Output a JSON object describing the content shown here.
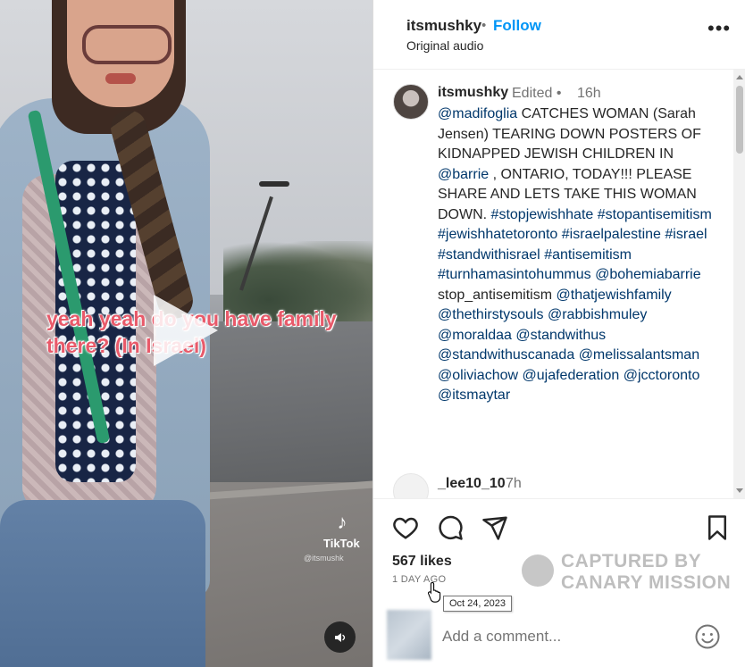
{
  "video": {
    "overlay_text": "yeah yeah do you have family there? (In Israel)",
    "tiktok_label": "TikTok",
    "tiktok_handle": "@itsmushk"
  },
  "header": {
    "username": "itsmushky",
    "separator": "•",
    "follow_label": "Follow",
    "audio_label": "Original audio",
    "more_icon": "more-horizontal-icon"
  },
  "caption": {
    "username": "itsmushky",
    "edited": "Edited •",
    "time": "16h",
    "segments": [
      {
        "text": "@madifoglia",
        "tag": true
      },
      {
        "text": " CATCHES WOMAN (Sarah Jensen) TEARING DOWN POSTERS OF KIDNAPPED JEWISH CHILDREN IN ",
        "tag": false
      },
      {
        "text": "@barrie",
        "tag": true
      },
      {
        "text": " , ONTARIO, TODAY!!! PLEASE SHARE AND LETS TAKE THIS WOMAN DOWN. ",
        "tag": false
      },
      {
        "text": "#stopjewishhate",
        "tag": true
      },
      {
        "text": " ",
        "tag": false
      },
      {
        "text": "#stopantisemitism",
        "tag": true
      },
      {
        "text": " ",
        "tag": false
      },
      {
        "text": "#jewishhatetoronto",
        "tag": true
      },
      {
        "text": " ",
        "tag": false
      },
      {
        "text": "#israelpalestine",
        "tag": true
      },
      {
        "text": " ",
        "tag": false
      },
      {
        "text": "#israel",
        "tag": true
      },
      {
        "text": " ",
        "tag": false
      },
      {
        "text": "#standwithisrael",
        "tag": true
      },
      {
        "text": " ",
        "tag": false
      },
      {
        "text": "#antisemitism",
        "tag": true
      },
      {
        "text": " ",
        "tag": false
      },
      {
        "text": "#turnhamasintohummus",
        "tag": true
      },
      {
        "text": " ",
        "tag": false
      },
      {
        "text": "@bohemiabarrie",
        "tag": true
      },
      {
        "text": " stop_antisemitism ",
        "tag": false
      },
      {
        "text": "@thatjewishfamily",
        "tag": true
      },
      {
        "text": " ",
        "tag": false
      },
      {
        "text": "@thethirstysouls",
        "tag": true
      },
      {
        "text": " ",
        "tag": false
      },
      {
        "text": "@rabbishmuley",
        "tag": true
      },
      {
        "text": " ",
        "tag": false
      },
      {
        "text": "@moraldaa",
        "tag": true
      },
      {
        "text": " ",
        "tag": false
      },
      {
        "text": "@standwithus",
        "tag": true
      },
      {
        "text": " ",
        "tag": false
      },
      {
        "text": "@standwithuscanada",
        "tag": true
      },
      {
        "text": " ",
        "tag": false
      },
      {
        "text": "@melissalantsman",
        "tag": true
      },
      {
        "text": " ",
        "tag": false
      },
      {
        "text": "@oliviachow",
        "tag": true
      },
      {
        "text": " ",
        "tag": false
      },
      {
        "text": "@ujafederation",
        "tag": true
      },
      {
        "text": " ",
        "tag": false
      },
      {
        "text": "@jcctoronto",
        "tag": true
      },
      {
        "text": " ",
        "tag": false
      },
      {
        "text": "@itsmaytar",
        "tag": true
      }
    ]
  },
  "comments": [
    {
      "username": "_lee10_10",
      "time": "7h"
    }
  ],
  "actions": {
    "likes": "567 likes",
    "ago": "1 DAY AGO",
    "tooltip": "Oct 24, 2023",
    "icons": [
      "heart-icon",
      "comment-icon",
      "share-icon",
      "bookmark-icon"
    ]
  },
  "watermark": {
    "line1": "CAPTURED BY",
    "line2": "CANARY MISSION"
  },
  "comment_box": {
    "placeholder": "Add a comment..."
  },
  "colors": {
    "link": "#00376b",
    "follow": "#0095f6",
    "overlay_text": "#e85a6a"
  }
}
